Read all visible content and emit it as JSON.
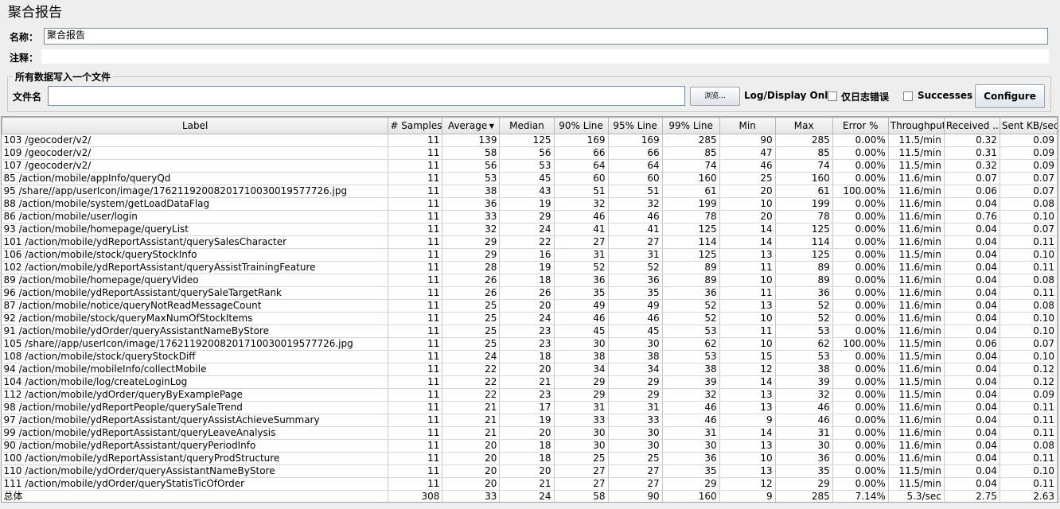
{
  "page": {
    "title": "聚合报告"
  },
  "form": {
    "name_label": "名称：",
    "name_value": "聚合报告",
    "comment_label": "注释：",
    "comment_value": "",
    "group_title": "所有数据写入一个文件",
    "filename_label": "文件名",
    "filename_value": "",
    "browse_label": "浏览...",
    "log_display_label": "Log/Display Only:",
    "errors_only_label": "仅日志错误",
    "errors_only_checked": false,
    "successes_label": "Successes",
    "successes_checked": false,
    "configure_label": "Configure"
  },
  "table": {
    "sorted_column": "Average",
    "sort_direction": "descending",
    "columns": [
      "Label",
      "# Samples",
      "Average",
      "Median",
      "90% Line",
      "95% Line",
      "99% Line",
      "Min",
      "Max",
      "Error %",
      "Throughput",
      "Received ...",
      "Sent KB/sec"
    ],
    "rows": [
      [
        "103 /geocoder/v2/",
        "11",
        "139",
        "125",
        "169",
        "169",
        "285",
        "90",
        "285",
        "0.00%",
        "11.5/min",
        "0.32",
        "0.09"
      ],
      [
        "109 /geocoder/v2/",
        "11",
        "58",
        "56",
        "66",
        "66",
        "85",
        "47",
        "85",
        "0.00%",
        "11.5/min",
        "0.31",
        "0.09"
      ],
      [
        "107 /geocoder/v2/",
        "11",
        "56",
        "53",
        "64",
        "64",
        "74",
        "46",
        "74",
        "0.00%",
        "11.5/min",
        "0.32",
        "0.09"
      ],
      [
        "85 /action/mobile/appInfo/queryQd",
        "11",
        "53",
        "45",
        "60",
        "60",
        "160",
        "25",
        "160",
        "0.00%",
        "11.6/min",
        "0.07",
        "0.07"
      ],
      [
        "95 /share//app/userIcon/image/17621192008201710030019577726.jpg",
        "11",
        "38",
        "43",
        "51",
        "51",
        "61",
        "20",
        "61",
        "100.00%",
        "11.6/min",
        "0.06",
        "0.07"
      ],
      [
        "88 /action/mobile/system/getLoadDataFlag",
        "11",
        "36",
        "19",
        "32",
        "32",
        "199",
        "10",
        "199",
        "0.00%",
        "11.6/min",
        "0.04",
        "0.08"
      ],
      [
        "86 /action/mobile/user/login",
        "11",
        "33",
        "29",
        "46",
        "46",
        "78",
        "20",
        "78",
        "0.00%",
        "11.6/min",
        "0.76",
        "0.10"
      ],
      [
        "93 /action/mobile/homepage/queryList",
        "11",
        "32",
        "24",
        "41",
        "41",
        "125",
        "14",
        "125",
        "0.00%",
        "11.6/min",
        "0.04",
        "0.07"
      ],
      [
        "101 /action/mobile/ydReportAssistant/querySalesCharacter",
        "11",
        "29",
        "22",
        "27",
        "27",
        "114",
        "14",
        "114",
        "0.00%",
        "11.6/min",
        "0.04",
        "0.11"
      ],
      [
        "106 /action/mobile/stock/queryStockInfo",
        "11",
        "29",
        "16",
        "31",
        "31",
        "125",
        "13",
        "125",
        "0.00%",
        "11.5/min",
        "0.04",
        "0.10"
      ],
      [
        "102 /action/mobile/ydReportAssistant/queryAssistTrainingFeature",
        "11",
        "28",
        "19",
        "52",
        "52",
        "89",
        "11",
        "89",
        "0.00%",
        "11.6/min",
        "0.04",
        "0.11"
      ],
      [
        "89 /action/mobile/homepage/queryVideo",
        "11",
        "26",
        "18",
        "36",
        "36",
        "89",
        "10",
        "89",
        "0.00%",
        "11.6/min",
        "0.04",
        "0.08"
      ],
      [
        "96 /action/mobile/ydReportAssistant/querySaleTargetRank",
        "11",
        "26",
        "26",
        "35",
        "35",
        "36",
        "11",
        "36",
        "0.00%",
        "11.6/min",
        "0.04",
        "0.11"
      ],
      [
        "87 /action/mobile/notice/queryNotReadMessageCount",
        "11",
        "25",
        "20",
        "49",
        "49",
        "52",
        "13",
        "52",
        "0.00%",
        "11.6/min",
        "0.04",
        "0.08"
      ],
      [
        "92 /action/mobile/stock/queryMaxNumOfStockItems",
        "11",
        "25",
        "24",
        "46",
        "46",
        "52",
        "10",
        "52",
        "0.00%",
        "11.6/min",
        "0.04",
        "0.10"
      ],
      [
        "91 /action/mobile/ydOrder/queryAssistantNameByStore",
        "11",
        "25",
        "23",
        "45",
        "45",
        "53",
        "11",
        "53",
        "0.00%",
        "11.6/min",
        "0.04",
        "0.10"
      ],
      [
        "105 /share//app/userIcon/image/17621192008201710030019577726.jpg",
        "11",
        "25",
        "23",
        "30",
        "30",
        "62",
        "10",
        "62",
        "100.00%",
        "11.5/min",
        "0.06",
        "0.07"
      ],
      [
        "108 /action/mobile/stock/queryStockDiff",
        "11",
        "24",
        "18",
        "38",
        "38",
        "53",
        "15",
        "53",
        "0.00%",
        "11.5/min",
        "0.04",
        "0.10"
      ],
      [
        "94 /action/mobile/mobileInfo/collectMobile",
        "11",
        "22",
        "20",
        "34",
        "34",
        "38",
        "12",
        "38",
        "0.00%",
        "11.6/min",
        "0.04",
        "0.12"
      ],
      [
        "104 /action/mobile/log/createLoginLog",
        "11",
        "22",
        "21",
        "29",
        "29",
        "39",
        "14",
        "39",
        "0.00%",
        "11.5/min",
        "0.04",
        "0.12"
      ],
      [
        "112 /action/mobile/ydOrder/queryByExamplePage",
        "11",
        "22",
        "23",
        "29",
        "29",
        "32",
        "13",
        "32",
        "0.00%",
        "11.5/min",
        "0.04",
        "0.09"
      ],
      [
        "98 /action/mobile/ydReportPeople/querySaleTrend",
        "11",
        "21",
        "17",
        "31",
        "31",
        "46",
        "13",
        "46",
        "0.00%",
        "11.6/min",
        "0.04",
        "0.11"
      ],
      [
        "97 /action/mobile/ydReportAssistant/queryAssistAchieveSummary",
        "11",
        "21",
        "19",
        "33",
        "33",
        "46",
        "9",
        "46",
        "0.00%",
        "11.6/min",
        "0.04",
        "0.11"
      ],
      [
        "99 /action/mobile/ydReportAssistant/queryLeaveAnalysis",
        "11",
        "21",
        "20",
        "30",
        "30",
        "31",
        "14",
        "31",
        "0.00%",
        "11.6/min",
        "0.04",
        "0.11"
      ],
      [
        "90 /action/mobile/ydReportAssistant/queryPeriodInfo",
        "11",
        "20",
        "18",
        "30",
        "30",
        "30",
        "13",
        "30",
        "0.00%",
        "11.6/min",
        "0.04",
        "0.08"
      ],
      [
        "100 /action/mobile/ydReportAssistant/queryProdStructure",
        "11",
        "20",
        "18",
        "25",
        "25",
        "36",
        "10",
        "36",
        "0.00%",
        "11.6/min",
        "0.04",
        "0.11"
      ],
      [
        "110 /action/mobile/ydOrder/queryAssistantNameByStore",
        "11",
        "20",
        "20",
        "27",
        "27",
        "35",
        "13",
        "35",
        "0.00%",
        "11.5/min",
        "0.04",
        "0.10"
      ],
      [
        "111 /action/mobile/ydOrder/queryStatisTicOfOrder",
        "11",
        "20",
        "21",
        "27",
        "27",
        "29",
        "12",
        "29",
        "0.00%",
        "11.5/min",
        "0.04",
        "0.11"
      ]
    ],
    "total": [
      "总体",
      "308",
      "33",
      "24",
      "58",
      "90",
      "160",
      "9",
      "285",
      "7.14%",
      "5.3/sec",
      "2.75",
      "2.63"
    ]
  }
}
